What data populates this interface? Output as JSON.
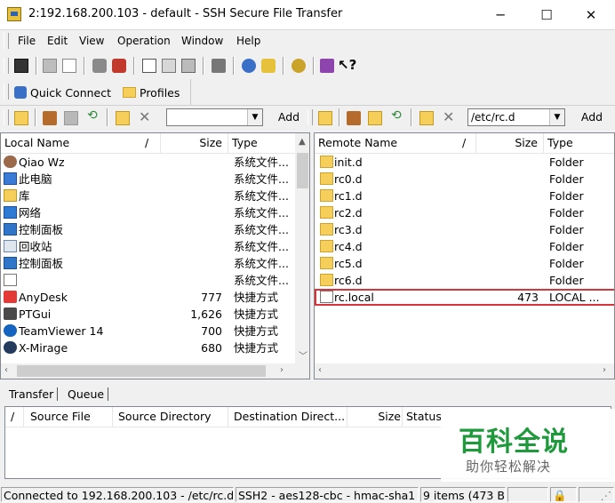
{
  "window": {
    "title": "2:192.168.200.103 - default - SSH Secure File Transfer",
    "minimize_glyph": "─",
    "maximize_glyph": "☐",
    "close_glyph": "✕"
  },
  "menu": [
    "File",
    "Edit",
    "View",
    "Operation",
    "Window",
    "Help"
  ],
  "quick": {
    "quick_connect": "Quick Connect",
    "profiles": "Profiles"
  },
  "local": {
    "path_value": "",
    "add_label": "Add",
    "columns": {
      "name": "Local Name",
      "sort": "/",
      "size": "Size",
      "type": "Type"
    },
    "rows": [
      {
        "name": "Qiao Wz",
        "size": "",
        "type": "系统文件...",
        "icon": "user-icon"
      },
      {
        "name": "此电脑",
        "size": "",
        "type": "系统文件...",
        "icon": "computer-icon"
      },
      {
        "name": "库",
        "size": "",
        "type": "系统文件...",
        "icon": "library-icon"
      },
      {
        "name": "网络",
        "size": "",
        "type": "系统文件...",
        "icon": "network-icon"
      },
      {
        "name": "控制面板",
        "size": "",
        "type": "系统文件...",
        "icon": "control-panel-icon"
      },
      {
        "name": "回收站",
        "size": "",
        "type": "系统文件...",
        "icon": "recycle-bin-icon"
      },
      {
        "name": "控制面板",
        "size": "",
        "type": "系统文件...",
        "icon": "control-panel-icon"
      },
      {
        "name": "",
        "size": "",
        "type": "系统文件...",
        "icon": "file-icon"
      },
      {
        "name": "AnyDesk",
        "size": "777",
        "type": "快捷方式",
        "icon": "anydesk-icon"
      },
      {
        "name": "PTGui",
        "size": "1,626",
        "type": "快捷方式",
        "icon": "ptgui-icon"
      },
      {
        "name": "TeamViewer 14",
        "size": "700",
        "type": "快捷方式",
        "icon": "teamviewer-icon"
      },
      {
        "name": "X-Mirage",
        "size": "680",
        "type": "快捷方式",
        "icon": "xmirage-icon"
      }
    ]
  },
  "remote": {
    "path_value": "/etc/rc.d",
    "add_label": "Add",
    "columns": {
      "name": "Remote Name",
      "sort": "/",
      "size": "Size",
      "type": "Type"
    },
    "rows": [
      {
        "name": "init.d",
        "size": "",
        "type": "Folder",
        "icon": "folder-icon"
      },
      {
        "name": "rc0.d",
        "size": "",
        "type": "Folder",
        "icon": "folder-icon"
      },
      {
        "name": "rc1.d",
        "size": "",
        "type": "Folder",
        "icon": "folder-icon"
      },
      {
        "name": "rc2.d",
        "size": "",
        "type": "Folder",
        "icon": "folder-icon"
      },
      {
        "name": "rc3.d",
        "size": "",
        "type": "Folder",
        "icon": "folder-icon"
      },
      {
        "name": "rc4.d",
        "size": "",
        "type": "Folder",
        "icon": "folder-icon"
      },
      {
        "name": "rc5.d",
        "size": "",
        "type": "Folder",
        "icon": "folder-icon"
      },
      {
        "name": "rc6.d",
        "size": "",
        "type": "Folder",
        "icon": "folder-icon"
      },
      {
        "name": "rc.local",
        "size": "473",
        "type": "LOCAL ...",
        "icon": "file-icon",
        "highlighted": true
      }
    ],
    "highlight_color": "#d9343a"
  },
  "transfer": {
    "tabs": [
      "Transfer",
      "Queue"
    ],
    "columns": [
      "/",
      "Source File",
      "Source Directory",
      "Destination Direct...",
      "Size",
      "Status"
    ]
  },
  "status": {
    "connection": "Connected to 192.168.200.103 - /etc/rc.d",
    "cipher": "SSH2 - aes128-cbc - hmac-sha1",
    "items": "9 items (473 B)"
  },
  "watermark": {
    "main": "百科全说",
    "sub": "助你轻松解决",
    "color": "#1e9a3c"
  }
}
